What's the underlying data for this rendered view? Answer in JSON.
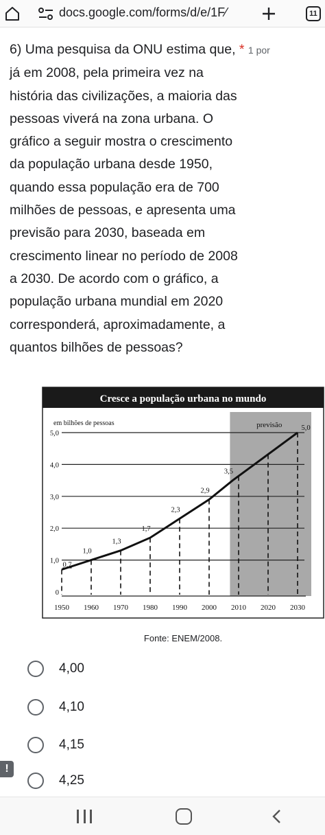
{
  "browser": {
    "url": "docs.google.com/forms/d/e/1F⁄",
    "tab_count": "11",
    "icons": [
      "home-icon",
      "tune-icon",
      "new-tab-icon",
      "tab-switcher-icon"
    ]
  },
  "question": {
    "number_text": "6) Uma pesquisa da ONU estima que,",
    "required_marker": "*",
    "points": "1 por",
    "body_lines": [
      "já em 2008, pela primeira vez na",
      "história das civilizações, a maioria das",
      "pessoas viverá na zona urbana. O",
      "gráfico a seguir mostra o crescimento",
      "da população urbana desde 1950,",
      "quando essa população era de 700",
      "milhões de pessoas, e apresenta uma",
      "previsão para 2030, baseada em",
      "crescimento linear no período de 2008",
      "a 2030.  De acordo com o gráfico, a",
      "população urbana mundial em 2020",
      "corresponderá, aproximadamente, a",
      "quantos bilhões de pessoas?"
    ]
  },
  "chart_data": {
    "type": "line",
    "title": "Cresce a população urbana no mundo",
    "ylabel": "em bilhões de pessoas",
    "forecast_label": "previsão",
    "x": [
      1950,
      1960,
      1970,
      1980,
      1990,
      2000,
      2010,
      2020,
      2030
    ],
    "x_ticks": [
      "1950",
      "1960",
      "1970",
      "1980",
      "1990",
      "2000",
      "2010",
      "2020",
      "2030"
    ],
    "y_ticks": [
      "0",
      "1,0",
      "2,0",
      "3,0",
      "4,0",
      "5,0"
    ],
    "ylim": [
      0,
      5
    ],
    "xlim": [
      1950,
      2030
    ],
    "forecast_range": [
      2008,
      2030
    ],
    "series": [
      {
        "points": [
          {
            "x": 1950,
            "y": 0.7,
            "label": "0,7"
          },
          {
            "x": 1960,
            "y": 1.0,
            "label": "1,0"
          },
          {
            "x": 1970,
            "y": 1.3,
            "label": "1,3"
          },
          {
            "x": 1980,
            "y": 1.7,
            "label": "1,7"
          },
          {
            "x": 1990,
            "y": 2.3,
            "label": "2,3"
          },
          {
            "x": 2000,
            "y": 2.9,
            "label": "2,9"
          },
          {
            "x": 2008,
            "y": 3.5,
            "label": "3,5"
          },
          {
            "x": 2030,
            "y": 5.0,
            "label": "5,0"
          }
        ]
      }
    ],
    "colors": {
      "title_bg": "#1a1a1a",
      "title_fg": "#ffffff",
      "forecast_bg": "#a9a9a9",
      "line": "#111111"
    },
    "source": "Fonte: ENEM/2008."
  },
  "options": [
    {
      "label": "4,00"
    },
    {
      "label": "4,10"
    },
    {
      "label": "4,15"
    },
    {
      "label": "4,25"
    }
  ],
  "warning_badge": "!",
  "navbar": {
    "icons": [
      "recents-icon",
      "home-nav-icon",
      "back-icon"
    ]
  }
}
